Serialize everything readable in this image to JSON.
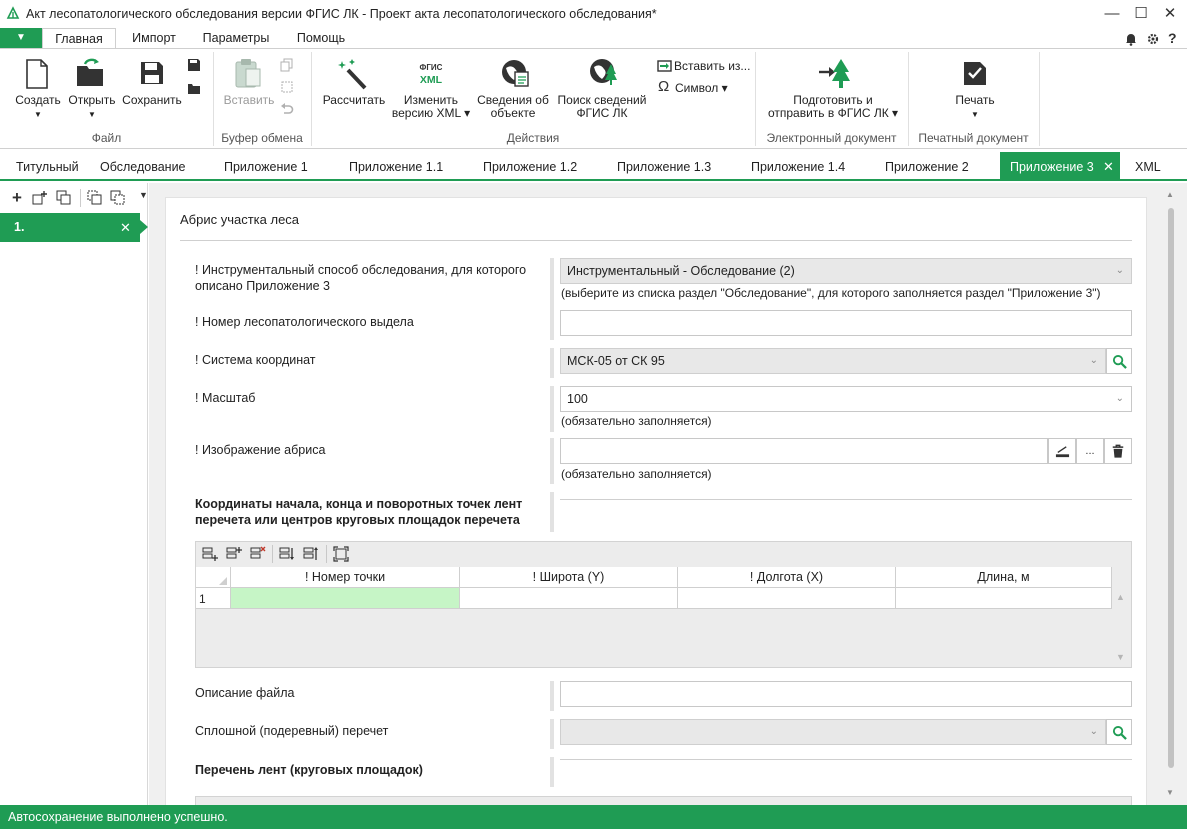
{
  "window": {
    "title": "Акт лесопатологического обследования версии ФГИС ЛК - Проект акта лесопатологического обследования*"
  },
  "menu": {
    "file_btn": "▼",
    "tabs": [
      "Главная",
      "Импорт",
      "Параметры",
      "Помощь"
    ]
  },
  "ribbon": {
    "groups": [
      "Файл",
      "Буфер обмена",
      "Действия",
      "Электронный документ",
      "Печатный документ"
    ],
    "create": "Создать",
    "open": "Открыть",
    "save": "Сохранить",
    "paste": "Вставить",
    "calculate": "Рассчитать",
    "fgis_logo_line1": "ФГИС",
    "fgis_logo_line2": "XML",
    "change_line1": "Изменить",
    "change_line2": "версию XML ▾",
    "info_line1": "Сведения об",
    "info_line2": "объекте",
    "search_line1": "Поиск сведений",
    "search_line2": "ФГИС ЛК",
    "insert_from": "Вставить из...",
    "symbol": "Символ ▾",
    "prepare_line1": "Подготовить и",
    "prepare_line2": "отправить в ФГИС ЛК ▾",
    "print": "Печать"
  },
  "doc_tabs": [
    "Титульный",
    "Обследование",
    "Приложение 1",
    "Приложение 1.1",
    "Приложение 1.2",
    "Приложение 1.3",
    "Приложение 1.4",
    "Приложение 2",
    "Приложение 3",
    "XML"
  ],
  "left_panel": {
    "item": "1."
  },
  "form": {
    "section_title": "Абрис участка леса",
    "survey_method_label_line1": "! Инструментальный способ обследования, для которого",
    "survey_method_label_line2": "описано Приложение 3",
    "survey_method_value": "Инструментальный - Обследование (2)",
    "survey_method_hint": "(выберите из списка раздел \"Обследование\", для которого заполняется раздел \"Приложение 3\")",
    "plot_number_label": "! Номер лесопатологического выдела",
    "plot_number_value": "",
    "coord_system_label": "! Система координат",
    "coord_system_value": "МСК-05 от СК 95",
    "scale_label": "! Масштаб",
    "scale_value": "100",
    "scale_hint": "(обязательно заполняется)",
    "image_label": "! Изображение абриса",
    "image_value": "",
    "image_hint": "(обязательно заполняется)",
    "image_browse": "...",
    "coords_title_line1": "Координаты начала, конца и поворотных точек лент",
    "coords_title_line2": "перечета или центров круговых площадок перечета",
    "file_desc_label": "Описание файла",
    "file_desc_value": "",
    "continuous_label": "Сплошной (подеревный) перечет",
    "continuous_value": "",
    "tapes_title": "Перечень лент (круговых площадок)"
  },
  "grid": {
    "columns": [
      "! Номер точки",
      "! Широта (Y)",
      "! Долгота (X)",
      "Длина, м"
    ],
    "rows": [
      {
        "num": "1",
        "cells": [
          "",
          "",
          "",
          ""
        ]
      }
    ]
  },
  "status": "Автосохранение выполнено успешно.",
  "colors": {
    "accent": "#1f9c54",
    "active_cell": "#c6f5c6"
  }
}
